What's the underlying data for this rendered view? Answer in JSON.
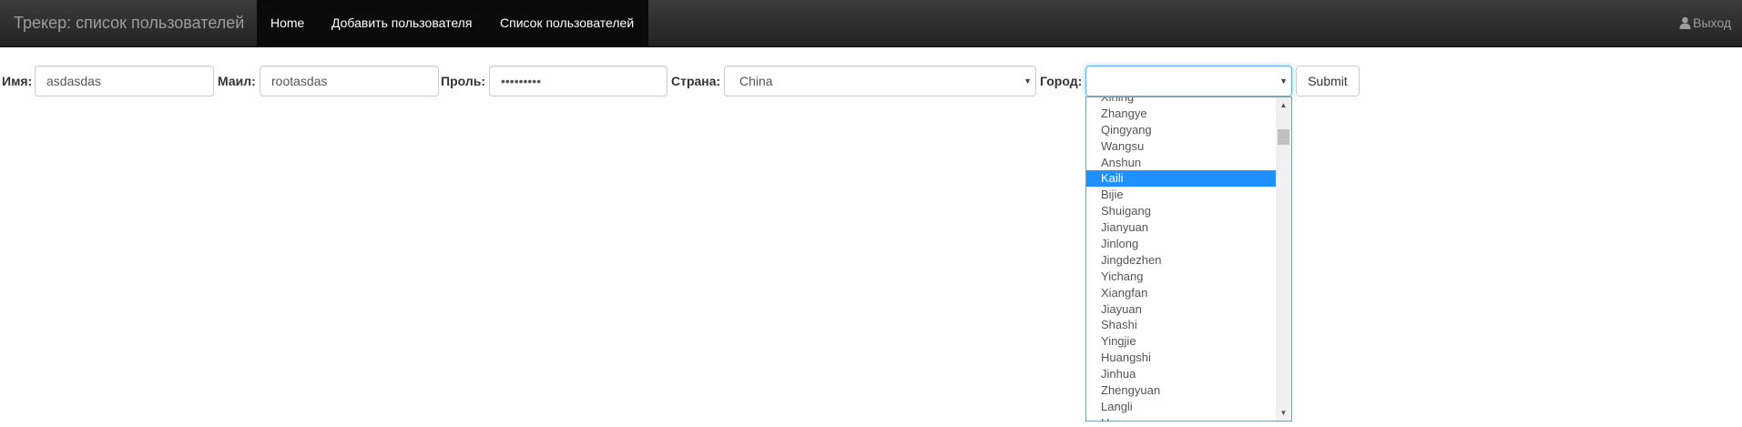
{
  "navbar": {
    "brand": "Трекер: список пользователей",
    "items": [
      {
        "label": "Home"
      },
      {
        "label": "Добавить пользователя"
      },
      {
        "label": "Список пользователей"
      }
    ],
    "logout": "Выход",
    "logout_icon": "user-icon"
  },
  "form": {
    "name_label": "Имя:",
    "name_value": "asdasdas",
    "email_label": "Маил:",
    "email_value": "rootasdas",
    "password_label": "Проль:",
    "password_value": "asdasdasd",
    "country_label": "Страна:",
    "country_value": "China",
    "city_label": "Город:",
    "city_value": "",
    "submit_label": "Submit"
  },
  "city_dropdown": {
    "options": [
      "Xining",
      "Zhangye",
      "Qingyang",
      "Wangsu",
      "Anshun",
      "Kaili",
      "Bijie",
      "Shuigang",
      "Jianyuan",
      "Jinlong",
      "Jingdezhen",
      "Yichang",
      "Xiangfan",
      "Jiayuan",
      "Shashi",
      "Yingjie",
      "Huangshi",
      "Jinhua",
      "Zhengyuan",
      "Langli",
      "Hongyang"
    ],
    "selected_option": "Kaili"
  },
  "colors": {
    "navbar_bg": "#222222",
    "active_nav_bg": "#0b0b0b",
    "selection": "#1e90ff",
    "focus_border": "#66afe9"
  }
}
